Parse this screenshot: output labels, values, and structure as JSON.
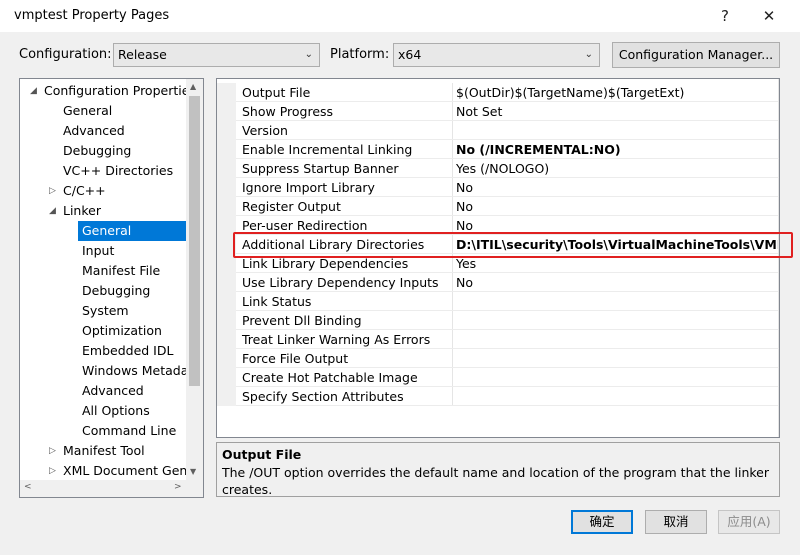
{
  "window": {
    "title": "vmptest Property Pages",
    "help_label": "?",
    "close_label": "✕"
  },
  "toolbar": {
    "configuration_label": "Configuration:",
    "configuration_value": "Release",
    "platform_label": "Platform:",
    "platform_value": "x64",
    "config_manager_label": "Configuration Manager..."
  },
  "tree": {
    "items": [
      {
        "label": "Configuration Properties",
        "arrow": "◢"
      },
      {
        "label": "General"
      },
      {
        "label": "Advanced"
      },
      {
        "label": "Debugging"
      },
      {
        "label": "VC++ Directories"
      },
      {
        "label": "C/C++",
        "arrow": "▷"
      },
      {
        "label": "Linker",
        "arrow": "◢"
      },
      {
        "label": "General",
        "selected": true
      },
      {
        "label": "Input"
      },
      {
        "label": "Manifest File"
      },
      {
        "label": "Debugging"
      },
      {
        "label": "System"
      },
      {
        "label": "Optimization"
      },
      {
        "label": "Embedded IDL"
      },
      {
        "label": "Windows Metadata"
      },
      {
        "label": "Advanced"
      },
      {
        "label": "All Options"
      },
      {
        "label": "Command Line"
      },
      {
        "label": "Manifest Tool",
        "arrow": "▷"
      },
      {
        "label": "XML Document Generator",
        "arrow": "▷"
      }
    ]
  },
  "properties": [
    {
      "name": "Output File",
      "value": "$(OutDir)$(TargetName)$(TargetExt)"
    },
    {
      "name": "Show Progress",
      "value": "Not Set"
    },
    {
      "name": "Version",
      "value": ""
    },
    {
      "name": "Enable Incremental Linking",
      "value": "No (/INCREMENTAL:NO)",
      "bold": true
    },
    {
      "name": "Suppress Startup Banner",
      "value": "Yes (/NOLOGO)"
    },
    {
      "name": "Ignore Import Library",
      "value": "No"
    },
    {
      "name": "Register Output",
      "value": "No"
    },
    {
      "name": "Per-user Redirection",
      "value": "No"
    },
    {
      "name": "Additional Library Directories",
      "value": "D:\\ITIL\\security\\Tools\\VirtualMachineTools\\VMProtect",
      "bold": true
    },
    {
      "name": "Link Library Dependencies",
      "value": "Yes"
    },
    {
      "name": "Use Library Dependency Inputs",
      "value": "No"
    },
    {
      "name": "Link Status",
      "value": ""
    },
    {
      "name": "Prevent Dll Binding",
      "value": ""
    },
    {
      "name": "Treat Linker Warning As Errors",
      "value": ""
    },
    {
      "name": "Force File Output",
      "value": ""
    },
    {
      "name": "Create Hot Patchable Image",
      "value": ""
    },
    {
      "name": "Specify Section Attributes",
      "value": ""
    }
  ],
  "description": {
    "title": "Output File",
    "text": "The /OUT option overrides the default name and location of the program that the linker creates."
  },
  "buttons": {
    "ok": "确定",
    "cancel": "取消",
    "apply": "应用(A)"
  },
  "colors": {
    "selection": "#0078d7",
    "highlight_box": "#e02020"
  }
}
